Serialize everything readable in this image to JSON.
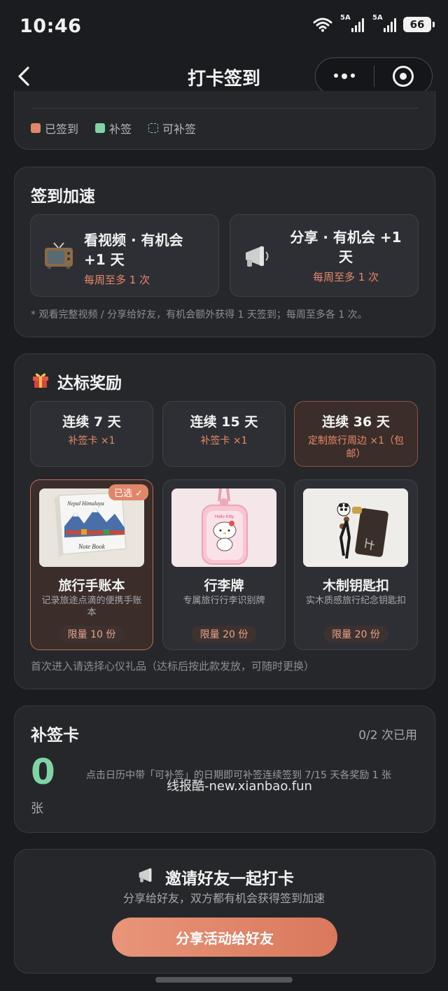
{
  "status_bar": {
    "time": "10:46",
    "battery": "66",
    "net1": "5A",
    "net2": "5A",
    "wifi_tag": "6"
  },
  "nav": {
    "title": "打卡签到"
  },
  "legend": {
    "items": [
      {
        "label": "已签到",
        "color": "#e0876a"
      },
      {
        "label": "补签",
        "color": "#7fd4a4"
      },
      {
        "label": "可补签",
        "color": "#7fd4a4"
      }
    ]
  },
  "boost": {
    "title": "签到加速",
    "video": {
      "title": "看视频 · 有机会 +1 天",
      "sub": "每周至多 1 次",
      "icon": "tv-icon"
    },
    "share": {
      "title": "分享 · 有机会 +1 天",
      "sub": "每周至多 1 次",
      "icon": "megaphone-icon"
    },
    "note": "* 观看完整视频 / 分享给好友，有机会额外获得 1 天签到；每周至多各 1 次。"
  },
  "reward": {
    "title": "达标奖励",
    "tiers": [
      {
        "days": "连续 7 天",
        "reward": "补签卡 ×1"
      },
      {
        "days": "连续 15 天",
        "reward": "补签卡 ×1"
      },
      {
        "days": "连续 36 天",
        "reward": "定制旅行周边 ×1（包邮）"
      }
    ],
    "gifts": [
      {
        "name": "旅行手账本",
        "desc": "记录旅途点滴的便携手账本",
        "limit": "限量 10 份",
        "badge": "已选 ✓",
        "cover_line1": "Nepal Himalaya",
        "cover_line2": "Note Book"
      },
      {
        "name": "行李牌",
        "desc": "专属旅行行李识别牌",
        "limit": "限量 20 份",
        "tag_text": "Hello Kitty"
      },
      {
        "name": "木制钥匙扣",
        "desc": "实木质感旅行纪念钥匙扣",
        "limit": "限量 20 份"
      }
    ],
    "note": "首次进入请选择心仪礼品（达标后按此款发放，可随时更换）"
  },
  "makeup": {
    "title": "补签卡",
    "used": "0/2 次已用",
    "count": "0",
    "unit": "张",
    "desc": "点击日历中带「可补签」的日期即可补签连续签到 7/15 天各奖励 1 张"
  },
  "watermark": "线报酷-new.xianbao.fun",
  "invite": {
    "title": "邀请好友一起打卡",
    "sub": "分享给好友，双方都有机会获得签到加速",
    "button": "分享活动给好友"
  }
}
